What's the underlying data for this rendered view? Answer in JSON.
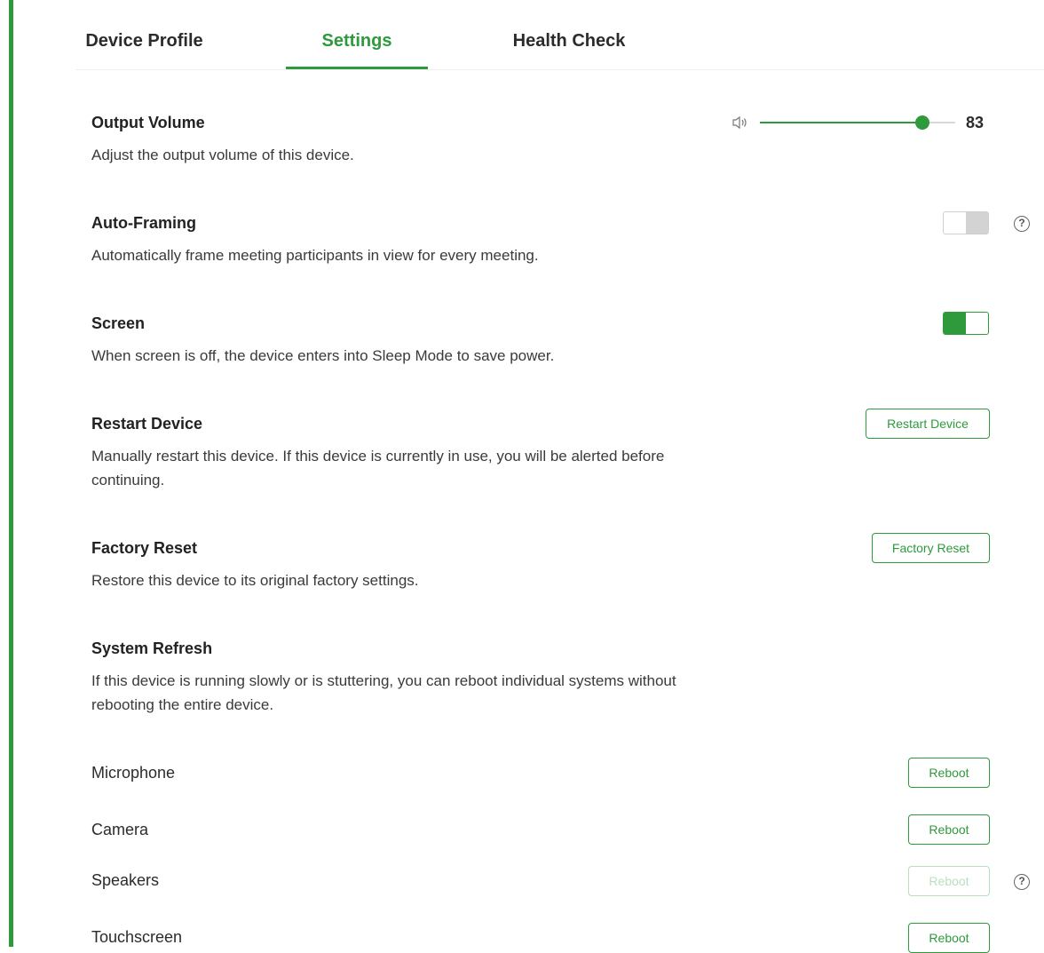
{
  "tabs": [
    {
      "label": "Device Profile"
    },
    {
      "label": "Settings"
    },
    {
      "label": "Health Check"
    }
  ],
  "active_tab": "Settings",
  "accent_color": "#2e9a3c",
  "output_volume": {
    "title": "Output Volume",
    "description": "Adjust the output volume of this device.",
    "value": "83",
    "level": 0.83,
    "icon": "speaker-icon"
  },
  "auto_framing": {
    "title": "Auto-Framing",
    "description": "Automatically frame meeting participants in view for every meeting.",
    "enabled": false
  },
  "screen": {
    "title": "Screen",
    "description": "When screen is off, the device enters into Sleep Mode to save power.",
    "enabled": true
  },
  "restart_device": {
    "title": "Restart Device",
    "description": "Manually restart this device. If this device is currently in use, you will be alerted before continuing.",
    "button_label": "Restart Device"
  },
  "factory_reset": {
    "title": "Factory Reset",
    "description": "Restore this device to its original factory settings.",
    "button_label": "Factory Reset"
  },
  "system_refresh": {
    "title": "System Refresh",
    "description": "If this device is running slowly or is stuttering, you can reboot individual systems without rebooting the entire device."
  },
  "systems": [
    {
      "label": "Microphone",
      "button_label": "Reboot",
      "disabled": false
    },
    {
      "label": "Camera",
      "button_label": "Reboot",
      "disabled": false
    },
    {
      "label": "Speakers",
      "button_label": "Reboot",
      "disabled": true
    },
    {
      "label": "Touchscreen",
      "button_label": "Reboot",
      "disabled": false
    }
  ],
  "help_icon_glyph": "?"
}
